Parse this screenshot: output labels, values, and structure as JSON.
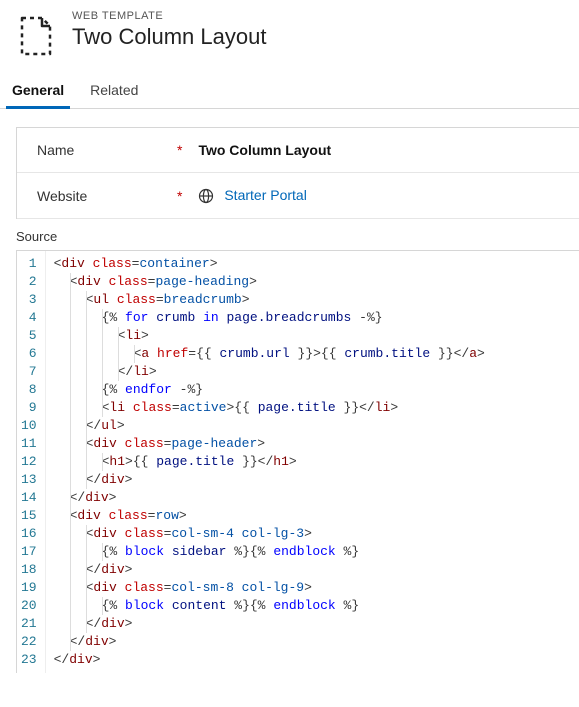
{
  "header": {
    "eyebrow": "WEB TEMPLATE",
    "title": "Two Column Layout"
  },
  "tabs": [
    {
      "label": "General",
      "active": true
    },
    {
      "label": "Related",
      "active": false
    }
  ],
  "fields": {
    "name": {
      "label": "Name",
      "value": "Two Column Layout"
    },
    "website": {
      "label": "Website",
      "link": "Starter Portal"
    }
  },
  "source": {
    "label": "Source",
    "lines": [
      {
        "n": 1,
        "indent": 0,
        "html": "<span class='t-delim'>&lt;</span><span class='t-tag'>div</span> <span class='t-attr'>class</span><span class='t-delim'>=</span><span class='t-val'>container</span><span class='t-delim'>&gt;</span>"
      },
      {
        "n": 2,
        "indent": 1,
        "html": "<span class='t-delim'>&lt;</span><span class='t-tag'>div</span> <span class='t-attr'>class</span><span class='t-delim'>=</span><span class='t-val'>page-heading</span><span class='t-delim'>&gt;</span>"
      },
      {
        "n": 3,
        "indent": 2,
        "html": "<span class='t-delim'>&lt;</span><span class='t-tag'>ul</span> <span class='t-attr'>class</span><span class='t-delim'>=</span><span class='t-val'>breadcrumb</span><span class='t-delim'>&gt;</span>"
      },
      {
        "n": 4,
        "indent": 3,
        "html": "<span class='t-delim'>{%</span> <span class='t-kw'>for</span> <span class='t-var'>crumb</span> <span class='t-kw'>in</span> <span class='t-var'>page.breadcrumbs</span> <span class='t-delim'>-%}</span>"
      },
      {
        "n": 5,
        "indent": 4,
        "html": "<span class='t-delim'>&lt;</span><span class='t-tag'>li</span><span class='t-delim'>&gt;</span>"
      },
      {
        "n": 6,
        "indent": 5,
        "html": "<span class='t-delim'>&lt;</span><span class='t-tag'>a</span> <span class='t-attr'>href</span><span class='t-delim'>={{</span> <span class='t-var'>crumb.url</span> <span class='t-delim'>}}&gt;{{</span> <span class='t-var'>crumb.title</span> <span class='t-delim'>}}&lt;/</span><span class='t-tag'>a</span><span class='t-delim'>&gt;</span>"
      },
      {
        "n": 7,
        "indent": 4,
        "html": "<span class='t-delim'>&lt;/</span><span class='t-tag'>li</span><span class='t-delim'>&gt;</span>"
      },
      {
        "n": 8,
        "indent": 3,
        "html": "<span class='t-delim'>{%</span> <span class='t-kw'>endfor</span> <span class='t-delim'>-%}</span>"
      },
      {
        "n": 9,
        "indent": 3,
        "html": "<span class='t-delim'>&lt;</span><span class='t-tag'>li</span> <span class='t-attr'>class</span><span class='t-delim'>=</span><span class='t-val'>active</span><span class='t-delim'>&gt;{{</span> <span class='t-var'>page.title</span> <span class='t-delim'>}}&lt;/</span><span class='t-tag'>li</span><span class='t-delim'>&gt;</span>"
      },
      {
        "n": 10,
        "indent": 2,
        "html": "<span class='t-delim'>&lt;/</span><span class='t-tag'>ul</span><span class='t-delim'>&gt;</span>"
      },
      {
        "n": 11,
        "indent": 2,
        "html": "<span class='t-delim'>&lt;</span><span class='t-tag'>div</span> <span class='t-attr'>class</span><span class='t-delim'>=</span><span class='t-val'>page-header</span><span class='t-delim'>&gt;</span>"
      },
      {
        "n": 12,
        "indent": 3,
        "html": "<span class='t-delim'>&lt;</span><span class='t-tag'>h1</span><span class='t-delim'>&gt;{{</span> <span class='t-var'>page.title</span> <span class='t-delim'>}}&lt;/</span><span class='t-tag'>h1</span><span class='t-delim'>&gt;</span>"
      },
      {
        "n": 13,
        "indent": 2,
        "html": "<span class='t-delim'>&lt;/</span><span class='t-tag'>div</span><span class='t-delim'>&gt;</span>"
      },
      {
        "n": 14,
        "indent": 1,
        "html": "<span class='t-delim'>&lt;/</span><span class='t-tag'>div</span><span class='t-delim'>&gt;</span>"
      },
      {
        "n": 15,
        "indent": 1,
        "html": "<span class='t-delim'>&lt;</span><span class='t-tag'>div</span> <span class='t-attr'>class</span><span class='t-delim'>=</span><span class='t-val'>row</span><span class='t-delim'>&gt;</span>"
      },
      {
        "n": 16,
        "indent": 2,
        "html": "<span class='t-delim'>&lt;</span><span class='t-tag'>div</span> <span class='t-attr'>class</span><span class='t-delim'>=</span><span class='t-val'>col-sm-4 col-lg-3</span><span class='t-delim'>&gt;</span>"
      },
      {
        "n": 17,
        "indent": 3,
        "html": "<span class='t-delim'>{%</span> <span class='t-kw'>block</span> <span class='t-var'>sidebar</span> <span class='t-delim'>%}{%</span> <span class='t-kw'>endblock</span> <span class='t-delim'>%}</span>"
      },
      {
        "n": 18,
        "indent": 2,
        "html": "<span class='t-delim'>&lt;/</span><span class='t-tag'>div</span><span class='t-delim'>&gt;</span>"
      },
      {
        "n": 19,
        "indent": 2,
        "html": "<span class='t-delim'>&lt;</span><span class='t-tag'>div</span> <span class='t-attr'>class</span><span class='t-delim'>=</span><span class='t-val'>col-sm-8 col-lg-9</span><span class='t-delim'>&gt;</span>"
      },
      {
        "n": 20,
        "indent": 3,
        "html": "<span class='t-delim'>{%</span> <span class='t-kw'>block</span> <span class='t-var'>content</span> <span class='t-delim'>%}{%</span> <span class='t-kw'>endblock</span> <span class='t-delim'>%}</span>"
      },
      {
        "n": 21,
        "indent": 2,
        "html": "<span class='t-delim'>&lt;/</span><span class='t-tag'>div</span><span class='t-delim'>&gt;</span>"
      },
      {
        "n": 22,
        "indent": 1,
        "html": "<span class='t-delim'>&lt;/</span><span class='t-tag'>div</span><span class='t-delim'>&gt;</span>"
      },
      {
        "n": 23,
        "indent": 0,
        "html": "<span class='t-delim'>&lt;/</span><span class='t-tag'>div</span><span class='t-delim'>&gt;</span>"
      }
    ]
  },
  "req_mark": "*"
}
